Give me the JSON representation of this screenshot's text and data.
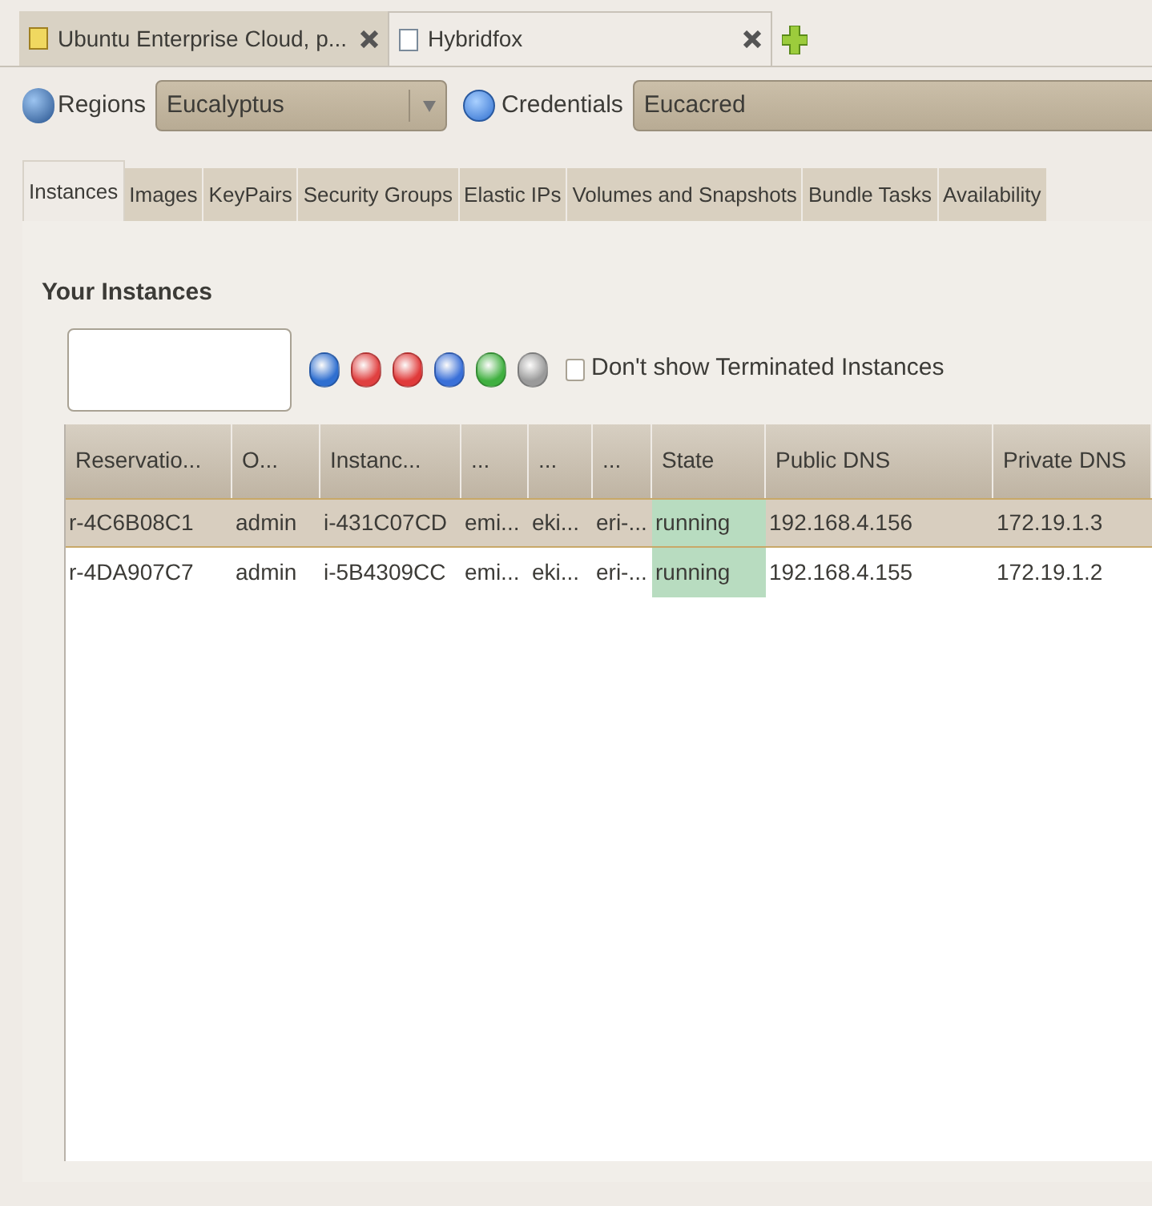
{
  "browser_tabs": [
    {
      "title": "Ubuntu Enterprise Cloud, p...",
      "selected": false
    },
    {
      "title": "Hybridfox",
      "selected": true
    }
  ],
  "toolbar": {
    "regions_label": "Regions",
    "region_value": "Eucalyptus",
    "credentials_label": "Credentials",
    "credentials_value": "Eucacred"
  },
  "tabs": [
    {
      "label": "Instances",
      "selected": true
    },
    {
      "label": "Images",
      "selected": false
    },
    {
      "label": "KeyPairs",
      "selected": false
    },
    {
      "label": "Security Groups",
      "selected": false
    },
    {
      "label": "Elastic IPs",
      "selected": false
    },
    {
      "label": "Volumes and Snapshots",
      "selected": false
    },
    {
      "label": "Bundle Tasks",
      "selected": false
    },
    {
      "label": "Availability",
      "selected": false
    }
  ],
  "section_title": "Your Instances",
  "filter": {
    "label": "Don't show Terminated Instances",
    "checked": false
  },
  "table": {
    "columns": [
      "Reservatio...",
      "O...",
      "Instanc...",
      "...",
      "...",
      "...",
      "State",
      "Public DNS",
      "Private DNS"
    ],
    "rows": [
      {
        "selected": true,
        "cells": [
          "r-4C6B08C1",
          "admin",
          "i-431C07CD",
          "emi...",
          "eki...",
          "eri-...",
          "running",
          "192.168.4.156",
          "172.19.1.3"
        ]
      },
      {
        "selected": false,
        "cells": [
          "r-4DA907C7",
          "admin",
          "i-5B4309CC",
          "emi...",
          "eki...",
          "eri-...",
          "running",
          "192.168.4.155",
          "172.19.1.2"
        ]
      }
    ]
  }
}
